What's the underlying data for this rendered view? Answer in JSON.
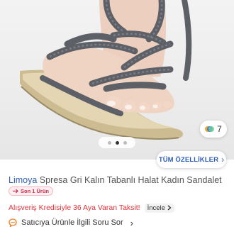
{
  "gallery": {
    "image_alt": "Gri halat sandalet giyilmiş ayak",
    "page_count": 3,
    "active_index": 1,
    "favorite_count": "7"
  },
  "features_button": {
    "label": "TÜM ÖZELLİKLER",
    "icon": "chevron-right-icon"
  },
  "product": {
    "brand": "Limoya",
    "name": "Spresa Gri Kalın Tabanlı Halat Kadın Sandalet"
  },
  "badge": {
    "label": "Son 1 Ürün",
    "icon": "low-stock-icon"
  },
  "promo": {
    "text": "Alışveriş Kredisiyle 36 Aya Varan Taksit!",
    "link_label": "İncele",
    "link_icon": "chevron-right-icon"
  },
  "ask": {
    "label": "Satıcıya Ürünle İlgili Soru Sor",
    "icon": "chat-bubble-icon"
  },
  "colors": {
    "brand_blue": "#2f5fb5",
    "promo_red": "#e2333b",
    "badge_red": "#d32f4f",
    "ask_icon_orange": "#f27a1a"
  }
}
